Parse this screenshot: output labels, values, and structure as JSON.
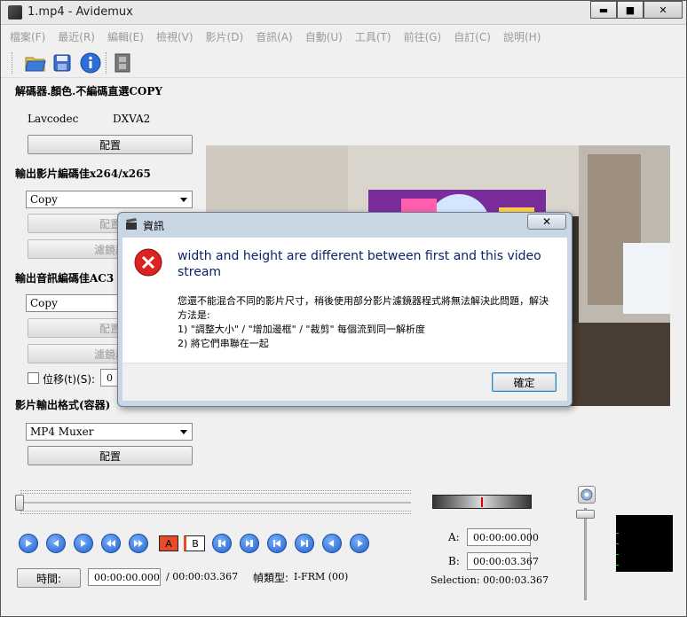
{
  "window": {
    "title": "1.mp4 - Avidemux",
    "minimize": "▬",
    "maximize": "■",
    "close": "✕"
  },
  "menu": [
    "檔案(F)",
    "最近(R)",
    "編輯(E)",
    "檢視(V)",
    "影片(D)",
    "音訊(A)",
    "自動(U)",
    "工具(T)",
    "前往(G)",
    "自訂(C)",
    "說明(H)"
  ],
  "decoder": {
    "title": "解碼器.顏色.不編碼直選COPY",
    "name": "Lavcodec",
    "hw": "DXVA2",
    "config_label": "配置"
  },
  "video_output": {
    "title": "輸出影片編碼佳x264/x265",
    "codec": "Copy",
    "config_label": "配置",
    "filters_label": "濾鏡器"
  },
  "audio_output": {
    "title": "輸出音訊編碼佳AC3",
    "codec": "Copy",
    "config_label": "配置",
    "filters_label": "濾鏡器",
    "shift_label": "位移(t)(S):",
    "shift_value": "0"
  },
  "container": {
    "title": "影片輸出格式(容器)",
    "format": "MP4 Muxer",
    "config_label": "配置"
  },
  "dialog": {
    "title": "資訊",
    "close": "✕",
    "heading": "width and height are different between first and this video stream",
    "body_line1": "您還不能混合不同的影片尺寸，稍後使用部分影片濾鏡器程式將無法解決此問題，解決方法是:",
    "body_line2": "1) \"調整大小\" / \"增加邊框\" / \"裁剪\" 每個流到同一解析度",
    "body_line3": "2) 將它們串聯在一起",
    "ok_label": "確定"
  },
  "status": {
    "time_button": "時間:",
    "current_time": "00:00:00.000",
    "total_time": "/ 00:00:03.367",
    "frame_type_label": "幀類型:",
    "frame_type": "I-FRM (00)",
    "a_label": "A:",
    "a_value": "00:00:00.000",
    "b_label": "B:",
    "b_value": "00:00:03.367",
    "selection": "Selection: 00:00:03.367"
  },
  "markers": {
    "a": "A",
    "b": "B"
  }
}
